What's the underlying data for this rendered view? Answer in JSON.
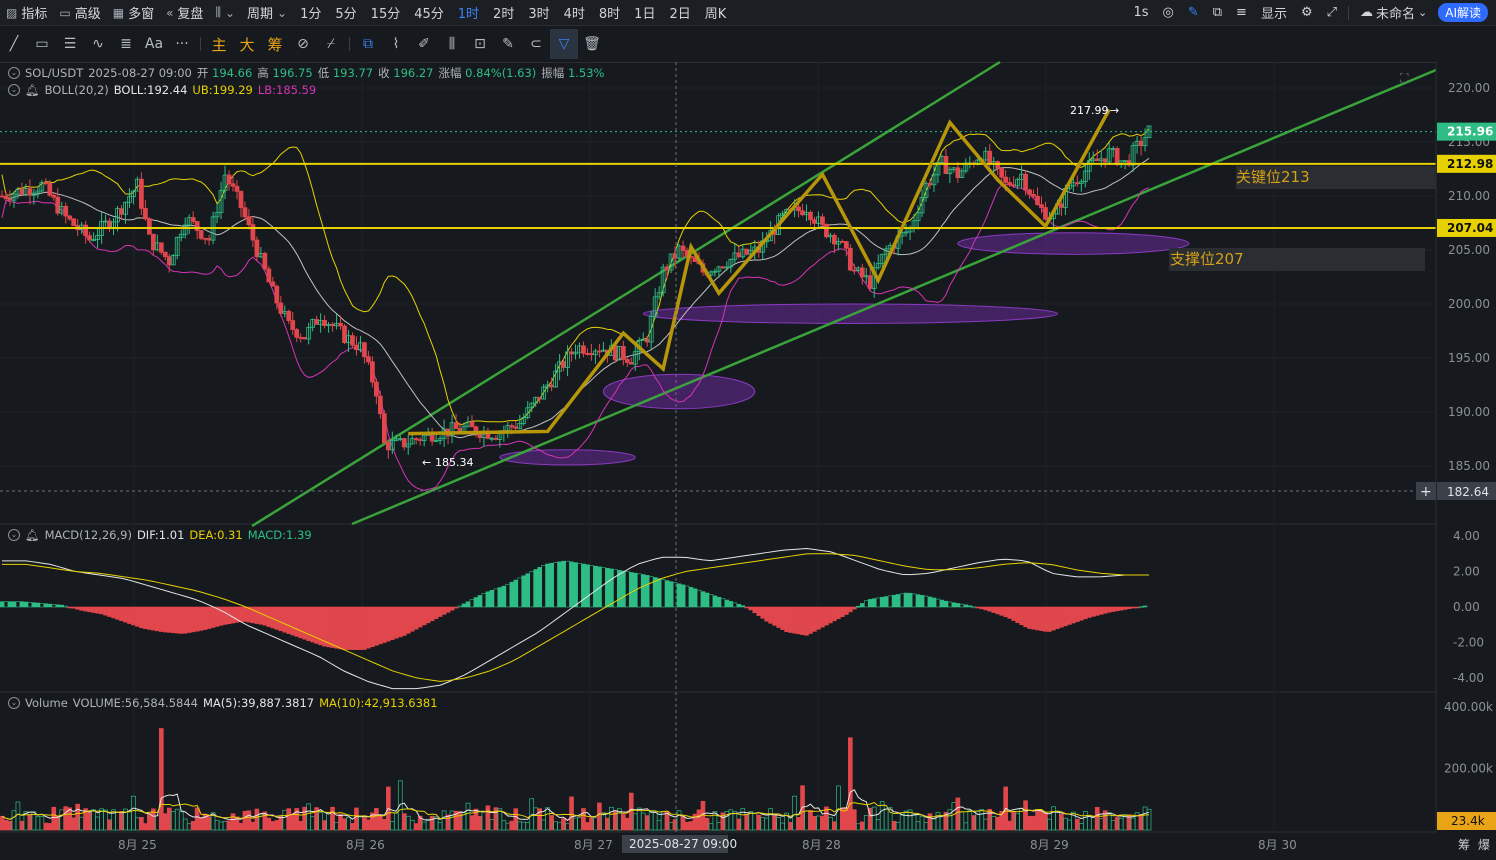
{
  "toolbar": {
    "indicators": "指标",
    "advanced": "高级",
    "multi_window": "多窗",
    "replay": "复盘",
    "period": "周期",
    "intervals": [
      "1分",
      "5分",
      "15分",
      "45分",
      "1时",
      "2时",
      "3时",
      "4时",
      "8时",
      "1日",
      "2日",
      "周K"
    ],
    "active_interval": "1时",
    "interval_1s": "1s",
    "display": "显示",
    "unnamed": "未命名",
    "ai": "AI解读"
  },
  "drawing_tools": {
    "main": "主",
    "big": "大",
    "chip": "筹",
    "aa": "Aa",
    "more": "···"
  },
  "legend": {
    "pair": "SOL/USDT",
    "datetime": "2025-08-27 09:00",
    "open_label": "开",
    "open": "194.66",
    "high_label": "高",
    "high": "196.75",
    "low_label": "低",
    "low": "193.77",
    "close_label": "收",
    "close": "196.27",
    "change_label": "涨幅",
    "change": "0.84%(1.63)",
    "amp_label": "振幅",
    "amp": "1.53%",
    "boll": "BOLL(20,2)",
    "boll_mid": "BOLL:192.44",
    "boll_ub": "UB:199.29",
    "boll_lb": "LB:185.59",
    "macd": "MACD(12,26,9)",
    "dif": "DIF:1.01",
    "dea": "DEA:0.31",
    "macd_val": "MACD:1.39",
    "vol": "Volume",
    "volume": "VOLUME:56,584.5844",
    "ma5": "MA(5):39,887.3817",
    "ma10": "MA(10):42,913.6381"
  },
  "annotations": {
    "key_level": "关键位213",
    "support_level": "支撑位207",
    "high_marker": "217.99",
    "low_marker": "185.34",
    "crosshair_time": "2025-08-27 09:00",
    "crosshair_price": "182.64"
  },
  "colors": {
    "up": "#2ebd85",
    "down": "#e0474c",
    "boll_mid": "#c0c0c0",
    "boll_ub": "#e8d100",
    "boll_lb": "#d633b5",
    "horizontal": "#e8d100",
    "channel": "#3aa33a",
    "zigzag": "#b8960a",
    "ellipse": "#6a2a9a"
  },
  "chart_data": [
    {
      "type": "candlestick",
      "title": "SOL/USDT 1H",
      "y_ticks": [
        "220.00",
        "215.00",
        "210.00",
        "205.00",
        "200.00",
        "195.00",
        "190.00",
        "185.00"
      ],
      "ylim": [
        182,
        222
      ],
      "x_ticks": [
        "8月 25",
        "8月 26",
        "8月 27",
        "8月 28",
        "8月 29",
        "8月 30"
      ],
      "price_labels": {
        "last": "215.96",
        "key": "212.98",
        "support": "207.04"
      },
      "horizontal_levels": [
        212.98,
        207.04
      ],
      "last_price": 215.96,
      "high": 217.99,
      "low": 185.34,
      "path_close": [
        {
          "t": 0,
          "p": 210
        },
        {
          "t": 10,
          "p": 211
        },
        {
          "t": 16,
          "p": 208
        },
        {
          "t": 22,
          "p": 206
        },
        {
          "t": 28,
          "p": 208
        },
        {
          "t": 34,
          "p": 211
        },
        {
          "t": 37,
          "p": 206
        },
        {
          "t": 42,
          "p": 204
        },
        {
          "t": 46,
          "p": 208
        },
        {
          "t": 52,
          "p": 206
        },
        {
          "t": 56,
          "p": 212
        },
        {
          "t": 60,
          "p": 209
        },
        {
          "t": 64,
          "p": 205
        },
        {
          "t": 68,
          "p": 201
        },
        {
          "t": 72,
          "p": 198
        },
        {
          "t": 76,
          "p": 197
        },
        {
          "t": 80,
          "p": 199
        },
        {
          "t": 86,
          "p": 197
        },
        {
          "t": 90,
          "p": 196
        },
        {
          "t": 94,
          "p": 192
        },
        {
          "t": 96,
          "p": 187
        },
        {
          "t": 100,
          "p": 187
        },
        {
          "t": 108,
          "p": 188
        },
        {
          "t": 116,
          "p": 188.5
        },
        {
          "t": 124,
          "p": 188
        },
        {
          "t": 130,
          "p": 189
        },
        {
          "t": 136,
          "p": 192
        },
        {
          "t": 144,
          "p": 196
        },
        {
          "t": 150,
          "p": 196
        },
        {
          "t": 158,
          "p": 195
        },
        {
          "t": 162,
          "p": 197
        },
        {
          "t": 166,
          "p": 203
        },
        {
          "t": 170,
          "p": 205
        },
        {
          "t": 176,
          "p": 203
        },
        {
          "t": 182,
          "p": 204
        },
        {
          "t": 190,
          "p": 205
        },
        {
          "t": 196,
          "p": 208
        },
        {
          "t": 202,
          "p": 209
        },
        {
          "t": 206,
          "p": 207
        },
        {
          "t": 210,
          "p": 206
        },
        {
          "t": 214,
          "p": 203
        },
        {
          "t": 218,
          "p": 202
        },
        {
          "t": 222,
          "p": 205
        },
        {
          "t": 228,
          "p": 207
        },
        {
          "t": 232,
          "p": 211
        },
        {
          "t": 236,
          "p": 213
        },
        {
          "t": 240,
          "p": 212
        },
        {
          "t": 246,
          "p": 214
        },
        {
          "t": 252,
          "p": 211
        },
        {
          "t": 256,
          "p": 212
        },
        {
          "t": 260,
          "p": 209
        },
        {
          "t": 264,
          "p": 208
        },
        {
          "t": 268,
          "p": 211
        },
        {
          "t": 274,
          "p": 213
        },
        {
          "t": 278,
          "p": 214
        },
        {
          "t": 282,
          "p": 213
        },
        {
          "t": 286,
          "p": 215
        },
        {
          "t": 288,
          "p": 216
        }
      ]
    },
    {
      "type": "bar",
      "title": "MACD(12,26,9)",
      "y_ticks": [
        "4.00",
        "2.00",
        "0.00",
        "-2.00",
        "-4.00"
      ],
      "ylim": [
        -4.6,
        4.4
      ],
      "series": [
        {
          "name": "DIF",
          "values": [
            2.6,
            2.6,
            2.4,
            2.0,
            1.8,
            1.6,
            1.2,
            0.8,
            0.4,
            -0.2,
            -1.0,
            -1.6,
            -2.2,
            -2.8,
            -3.6,
            -4.2,
            -4.6,
            -4.6,
            -4.4,
            -3.8,
            -3.0,
            -2.2,
            -1.4,
            -0.4,
            0.6,
            1.6,
            2.4,
            2.8,
            2.8,
            2.6,
            2.8,
            3.0,
            3.2,
            3.3,
            3.1,
            2.6,
            2.1,
            1.8,
            1.9,
            2.2,
            2.5,
            2.7,
            2.6,
            1.9,
            1.7,
            1.7,
            1.8,
            1.8
          ]
        },
        {
          "name": "DEA",
          "values": [
            2.4,
            2.4,
            2.2,
            2.0,
            1.9,
            1.7,
            1.5,
            1.2,
            0.9,
            0.5,
            0.0,
            -0.6,
            -1.2,
            -1.8,
            -2.4,
            -3.0,
            -3.6,
            -4.0,
            -4.2,
            -4.0,
            -3.6,
            -3.0,
            -2.2,
            -1.4,
            -0.6,
            0.2,
            1.0,
            1.6,
            2.0,
            2.2,
            2.4,
            2.6,
            2.8,
            3.0,
            3.0,
            2.9,
            2.6,
            2.3,
            2.1,
            2.1,
            2.2,
            2.4,
            2.5,
            2.4,
            2.1,
            1.9,
            1.8,
            1.8
          ]
        },
        {
          "name": "MACD",
          "values": [
            0.3,
            0.3,
            0.2,
            0.1,
            -0.2,
            -0.4,
            -0.8,
            -1.2,
            -1.4,
            -1.5,
            -1.3,
            -1.0,
            -0.8,
            -1.0,
            -1.4,
            -1.8,
            -2.2,
            -2.4,
            -2.4,
            -2.0,
            -1.6,
            -1.0,
            -0.4,
            0.2,
            0.8,
            1.2,
            1.8,
            2.4,
            2.6,
            2.4,
            2.2,
            2.0,
            1.8,
            1.5,
            1.2,
            0.8,
            0.4,
            0.0,
            -0.8,
            -1.4,
            -1.6,
            -1.0,
            -0.4,
            0.4,
            0.6,
            0.8,
            0.6,
            0.3,
            0.1,
            -0.2,
            -0.6,
            -1.2,
            -1.4,
            -1.0,
            -0.6,
            -0.3,
            -0.1,
            0.1
          ]
        }
      ]
    },
    {
      "type": "bar",
      "title": "Volume",
      "y_ticks": [
        "400.00k",
        "200.00k"
      ],
      "last_label": "23.4k",
      "ylim": [
        0,
        420000
      ]
    }
  ],
  "bottom": {
    "chip": "筹",
    "burst": "爆"
  }
}
